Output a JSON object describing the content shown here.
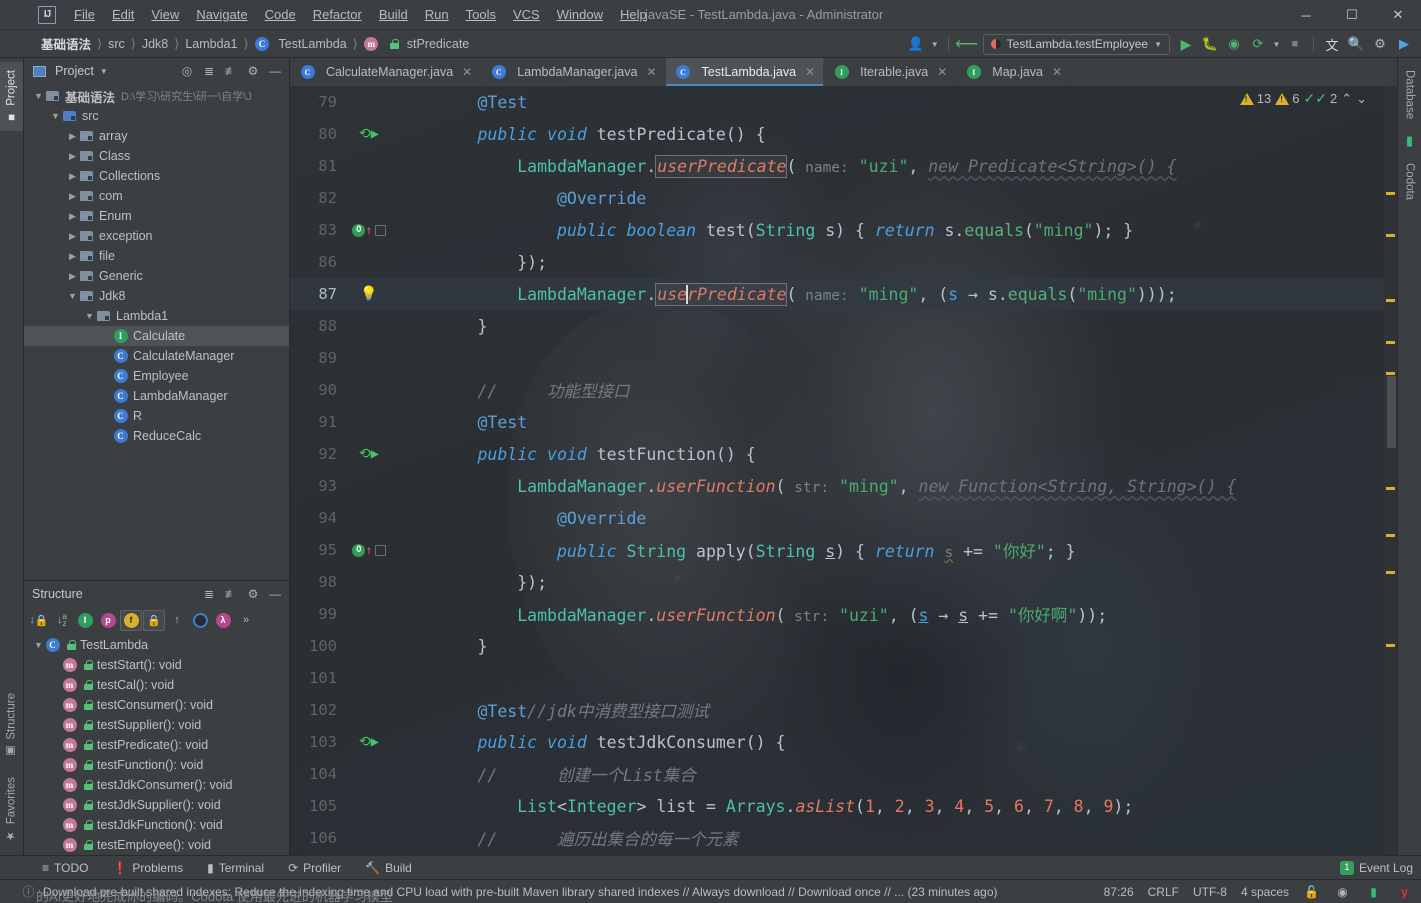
{
  "window": {
    "title": "javaSE - TestLambda.java - Administrator",
    "minimize": "─",
    "maximize": "☐",
    "close": "✕"
  },
  "menu": {
    "items": [
      "File",
      "Edit",
      "View",
      "Navigate",
      "Code",
      "Refactor",
      "Build",
      "Run",
      "Tools",
      "VCS",
      "Window",
      "Help"
    ]
  },
  "breadcrumb": {
    "items": [
      "基础语法",
      "src",
      "Jdk8",
      "Lambda1",
      "TestLambda",
      "stPredicate"
    ],
    "separator": "〉"
  },
  "toolbar": {
    "run_config": "TestLambda.testEmployee",
    "icons": [
      "user-icon",
      "vcs-update-icon",
      "run-icon",
      "debug-icon",
      "coverage-icon",
      "profile-icon",
      "stop-icon",
      "translate-icon",
      "search-icon",
      "settings-icon",
      "codota-icon"
    ]
  },
  "left_strip": {
    "project_tab": "Project",
    "structure_tab": "Structure",
    "favorites_tab": "Favorites"
  },
  "right_strip": {
    "database_tab": "Database",
    "codota_tab": "Codota"
  },
  "project_panel": {
    "title": "Project",
    "tree": [
      {
        "depth": 0,
        "arrow": "down",
        "icon": "project-folder-icon",
        "label": "基础语法",
        "path": "D:\\学习\\研究生\\研一\\自学\\J",
        "bold": true
      },
      {
        "depth": 1,
        "arrow": "down",
        "icon": "source-folder-icon",
        "label": "src"
      },
      {
        "depth": 2,
        "arrow": "right",
        "icon": "package-icon",
        "label": "array"
      },
      {
        "depth": 2,
        "arrow": "right",
        "icon": "package-icon",
        "label": "Class"
      },
      {
        "depth": 2,
        "arrow": "right",
        "icon": "package-icon",
        "label": "Collections"
      },
      {
        "depth": 2,
        "arrow": "right",
        "icon": "package-icon",
        "label": "com"
      },
      {
        "depth": 2,
        "arrow": "right",
        "icon": "package-icon",
        "label": "Enum"
      },
      {
        "depth": 2,
        "arrow": "right",
        "icon": "package-icon",
        "label": "exception"
      },
      {
        "depth": 2,
        "arrow": "right",
        "icon": "package-icon",
        "label": "file"
      },
      {
        "depth": 2,
        "arrow": "right",
        "icon": "package-icon",
        "label": "Generic"
      },
      {
        "depth": 2,
        "arrow": "down",
        "icon": "package-icon",
        "label": "Jdk8"
      },
      {
        "depth": 3,
        "arrow": "down",
        "icon": "package-icon",
        "label": "Lambda1"
      },
      {
        "depth": 4,
        "arrow": "none",
        "icon": "interface-icon",
        "label": "Calculate",
        "selected": true
      },
      {
        "depth": 4,
        "arrow": "none",
        "icon": "class-icon",
        "label": "CalculateManager"
      },
      {
        "depth": 4,
        "arrow": "none",
        "icon": "class-icon",
        "label": "Employee"
      },
      {
        "depth": 4,
        "arrow": "none",
        "icon": "class-icon",
        "label": "LambdaManager"
      },
      {
        "depth": 4,
        "arrow": "none",
        "icon": "class-icon",
        "label": "R"
      },
      {
        "depth": 4,
        "arrow": "none",
        "icon": "class-icon",
        "label": "ReduceCalc"
      }
    ]
  },
  "structure_panel": {
    "title": "Structure",
    "toolbar_icons": [
      "sort-by-visibility-icon",
      "sort-alphabetically-icon",
      "show-inherited-icon",
      "show-properties-icon",
      "show-fields-icon",
      "show-non-public-icon",
      "show-anonymous-icon",
      "group-icon",
      "lambda-icon",
      "more-icon"
    ],
    "root": "TestLambda",
    "members": [
      "testStart(): void",
      "testCal(): void",
      "testConsumer(): void",
      "testSupplier(): void",
      "testPredicate(): void",
      "testFunction(): void",
      "testJdkConsumer(): void",
      "testJdkSupplier(): void",
      "testJdkFunction(): void",
      "testEmployee(): void"
    ]
  },
  "editor_tabs": [
    {
      "label": "CalculateManager.java",
      "icon": "class-icon",
      "active": false
    },
    {
      "label": "LambdaManager.java",
      "icon": "class-icon",
      "active": false
    },
    {
      "label": "TestLambda.java",
      "icon": "test-class-icon",
      "active": true
    },
    {
      "label": "Iterable.java",
      "icon": "interface-icon",
      "active": false
    },
    {
      "label": "Map.java",
      "icon": "interface-icon",
      "active": false
    }
  ],
  "inspection_widget": {
    "warnings": "13",
    "weak_warnings": "6",
    "typos": "2",
    "prev_label": "⌃",
    "next_label": "⌄"
  },
  "code": {
    "lines": [
      {
        "num": "79",
        "marker": "",
        "text": "@Test"
      },
      {
        "num": "80",
        "marker": "run",
        "text": "public void testPredicate() {"
      },
      {
        "num": "81",
        "marker": "",
        "text": "LambdaManager.userPredicate( name: \"uzi\", new Predicate<String>() {"
      },
      {
        "num": "82",
        "marker": "",
        "text": "@Override"
      },
      {
        "num": "83",
        "marker": "override",
        "text": "public boolean test(String s) { return s.equals(\"ming\"); }"
      },
      {
        "num": "86",
        "marker": "",
        "text": "});"
      },
      {
        "num": "87",
        "marker": "bulb",
        "text": "LambdaManager.userPredicate( name: \"ming\", (s → s.equals(\"ming\")));",
        "current": true
      },
      {
        "num": "88",
        "marker": "",
        "text": "}"
      },
      {
        "num": "89",
        "marker": "",
        "text": ""
      },
      {
        "num": "90",
        "marker": "",
        "text": "//     功能型接口"
      },
      {
        "num": "91",
        "marker": "",
        "text": "@Test"
      },
      {
        "num": "92",
        "marker": "run",
        "text": "public void testFunction() {"
      },
      {
        "num": "93",
        "marker": "",
        "text": "LambdaManager.userFunction( str: \"ming\", new Function<String, String>() {"
      },
      {
        "num": "94",
        "marker": "",
        "text": "@Override"
      },
      {
        "num": "95",
        "marker": "override",
        "text": "public String apply(String s) { return s += \"你好\"; }"
      },
      {
        "num": "98",
        "marker": "",
        "text": "});"
      },
      {
        "num": "99",
        "marker": "",
        "text": "LambdaManager.userFunction( str: \"uzi\", (s → s += \"你好啊\"));"
      },
      {
        "num": "100",
        "marker": "",
        "text": "}"
      },
      {
        "num": "101",
        "marker": "",
        "text": ""
      },
      {
        "num": "102",
        "marker": "",
        "text": "@Test//jdk中消费型接口测试"
      },
      {
        "num": "103",
        "marker": "run",
        "text": "public void testJdkConsumer() {"
      },
      {
        "num": "104",
        "marker": "",
        "text": "//      创建一个List集合"
      },
      {
        "num": "105",
        "marker": "",
        "text": "List<Integer> list = Arrays.asList(1, 2, 3, 4, 5, 6, 7, 8, 9);"
      },
      {
        "num": "106",
        "marker": "",
        "text": "//      遍历出集合的每一个元素"
      }
    ]
  },
  "bottom_bar": {
    "items": [
      {
        "label": "TODO",
        "icon": "todo-icon"
      },
      {
        "label": "Problems",
        "icon": "problems-icon"
      },
      {
        "label": "Terminal",
        "icon": "terminal-icon"
      },
      {
        "label": "Profiler",
        "icon": "profiler-icon"
      },
      {
        "label": "Build",
        "icon": "build-icon"
      }
    ],
    "event_log": "Event Log",
    "event_count": "1"
  },
  "status_bar": {
    "message": "Download pre-built shared indexes: Reduce the indexing time and CPU load with pre-built Maven library shared indexes // Always download // Download once // ... (23 minutes ago)",
    "caret": "87:26",
    "line_sep": "CRLF",
    "encoding": "UTF-8",
    "indent": "4 spaces",
    "icons": [
      "lock-icon",
      "inspection-level-icon",
      "terminal-status-icon",
      "yandex-icon"
    ]
  },
  "ghost_text": {
    "bottom": "的AI更好地完成你的编码。Codota 使用最先进的机器学习模型"
  }
}
